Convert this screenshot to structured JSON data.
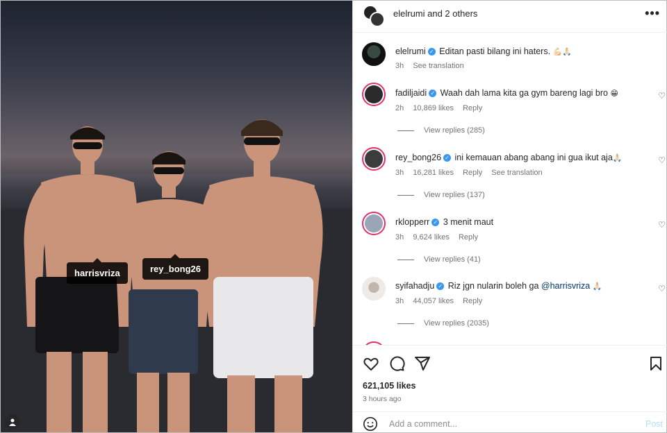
{
  "post_header": {
    "title": "elelrumi and 2 others",
    "more_icon": "more-options-icon"
  },
  "photo": {
    "tags": [
      {
        "label": "harrisvriza"
      },
      {
        "label": "rey_bong26"
      }
    ]
  },
  "comments": [
    {
      "username": "elelrumi",
      "text": "Editan pasti bilang ini haters.",
      "emoji": "💪🏻🙏🏻",
      "time": "3h",
      "likes": "",
      "reply": "",
      "translation": "See translation",
      "view_replies": ""
    },
    {
      "username": "fadiljaidi",
      "text": "Waah dah lama kita ga gym bareng lagi bro",
      "emoji": "😁",
      "time": "2h",
      "likes": "10,869 likes",
      "reply": "Reply",
      "translation": "",
      "view_replies": "View replies (285)"
    },
    {
      "username": "rey_bong26",
      "text": "ini kemauan abang abang ini gua ikut aja",
      "emoji": "🙏🏻",
      "time": "3h",
      "likes": "16,281 likes",
      "reply": "Reply",
      "translation": "See translation",
      "view_replies": "View replies (137)"
    },
    {
      "username": "rklopperr",
      "text": "3 menit maut",
      "emoji": "",
      "time": "3h",
      "likes": "9,624 likes",
      "reply": "Reply",
      "translation": "",
      "view_replies": "View replies (41)"
    },
    {
      "username": "syifahadju",
      "text": "Riz jgn nularin boleh ga",
      "mention": "@harrisvriza",
      "emoji": "🙏🏻",
      "time": "3h",
      "likes": "44,057 likes",
      "reply": "Reply",
      "translation": "",
      "view_replies": "View replies (2035)"
    }
  ],
  "actions": {
    "likes": "621,105 likes",
    "time_ago": "3 hours ago"
  },
  "add_comment": {
    "placeholder": "Add a comment...",
    "post_label": "Post"
  },
  "colors": {
    "verified": "#3897f0",
    "story_ring": "#e1306c",
    "post_button": "#b2dffc"
  }
}
